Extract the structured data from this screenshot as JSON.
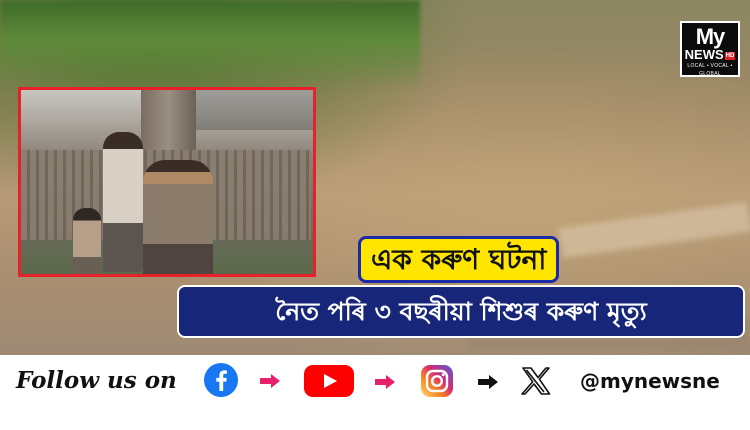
{
  "logo": {
    "line1": "My",
    "line2": "NEWS",
    "badge": "HD",
    "tagline": "LOCAL • VOCAL • GLOBAL"
  },
  "headline": {
    "top": "এক কৰুণ ঘটনা",
    "bottom": "নৈত পৰি ৩ বছৰীয়া শিশুৰ কৰুণ মৃত্যু"
  },
  "follow": {
    "text": "Follow us on",
    "handle": "@mynewsne",
    "icons": [
      "facebook-icon",
      "youtube-icon",
      "instagram-icon",
      "x-icon"
    ]
  },
  "colors": {
    "accent_yellow": "#ffe600",
    "banner_blue": "#18267a",
    "inset_border_red": "#e8202a",
    "facebook_blue": "#1877f2",
    "youtube_red": "#ff0000",
    "arrow_pink": "#e8206a"
  }
}
